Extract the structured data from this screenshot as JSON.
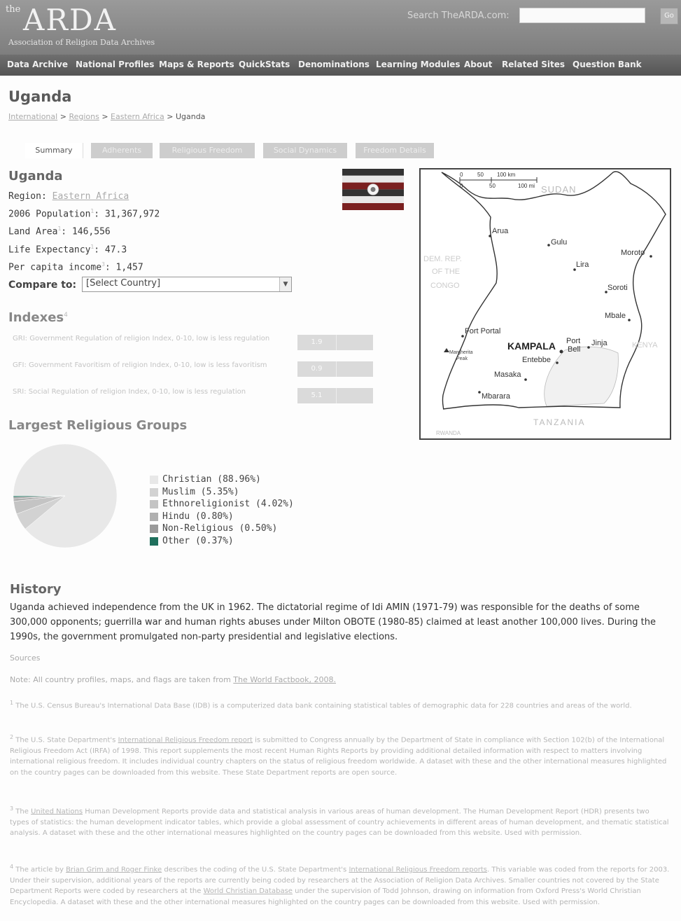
{
  "header": {
    "logo_the": "the",
    "logo_main": "ARDA",
    "logo_sub": "Association of Religion Data Archives",
    "search_label": "Search TheARDA.com:",
    "search_value": "",
    "go_label": "Go"
  },
  "nav": [
    "Data Archive",
    "National Profiles",
    "Maps & Reports",
    "QuickStats",
    "Denominations",
    "Learning Modules",
    "About",
    "Related Sites",
    "Question Bank"
  ],
  "page_title": "Uganda",
  "breadcrumb": {
    "items": [
      "International",
      "Regions",
      "Eastern Africa"
    ],
    "sep": ">",
    "current": "Uganda"
  },
  "tabs": [
    "Summary",
    "Adherents",
    "Religious Freedom",
    "Social Dynamics",
    "Freedom Details"
  ],
  "profile": {
    "heading": "Uganda",
    "region_label": "Region:",
    "region_value": "Eastern Africa",
    "population_label": "2006 Population",
    "population_sup": "1",
    "population_value": "31,367,972",
    "land_label": "Land Area",
    "land_sup": "1",
    "land_value": "146,556",
    "life_label": "Life Expectancy",
    "life_sup": "1",
    "life_value": "47.3",
    "income_label": "Per capita income",
    "income_sup": "3",
    "income_value": "1,457"
  },
  "flag": {
    "colors": [
      "#333333",
      "#e8e8e8",
      "#7a2020",
      "#333333",
      "#e8e8e8",
      "#7a2020"
    ]
  },
  "compare": {
    "label": "Compare to:",
    "selected": "[Select Country]"
  },
  "indexes": {
    "heading": "Indexes",
    "sup": "4",
    "items": [
      {
        "label": "GRI: Government Regulation of religion Index, 0-10, low is less regulation",
        "value": "1.9"
      },
      {
        "label": "GFI: Government Favoritism of religion Index, 0-10, low is less favoritism",
        "value": "0.9"
      },
      {
        "label": "SRI: Social Regulation of religion Index, 0-10, low is less regulation",
        "value": "5.1"
      }
    ]
  },
  "groups": {
    "heading": "Largest Religious Groups",
    "items": [
      {
        "label": "Christian (88.96%)",
        "pct": 88.96,
        "color": "#e8e8e8"
      },
      {
        "label": "Muslim (5.35%)",
        "pct": 5.35,
        "color": "#d2d2d2"
      },
      {
        "label": "Ethnoreligionist (4.02%)",
        "pct": 4.02,
        "color": "#c4c4c4"
      },
      {
        "label": "Hindu (0.80%)",
        "pct": 0.8,
        "color": "#b0b0b0"
      },
      {
        "label": "Non-Religious (0.50%)",
        "pct": 0.5,
        "color": "#9a9a9a"
      },
      {
        "label": "Other (0.37%)",
        "pct": 0.37,
        "color": "#1f6f5c"
      }
    ]
  },
  "map": {
    "scale_top": [
      "0",
      "50",
      "100 km"
    ],
    "scale_bottom": [
      "0",
      "50",
      "100 mi"
    ],
    "countries": [
      "SUDAN",
      "DEM. REP.",
      "OF THE",
      "CONGO",
      "KENYA",
      "TANZANIA",
      "RWANDA"
    ],
    "cities": [
      "Arua",
      "Gulu",
      "Lira",
      "Moroto",
      "Soroti",
      "Mbale",
      "Fort Portal",
      "Margherita",
      "Peak",
      "KAMPALA",
      "Port",
      "Bell",
      "Jinja",
      "Entebbe",
      "Masaka",
      "Mbarara"
    ]
  },
  "history": {
    "heading": "History",
    "text": "Uganda achieved independence from the UK in 1962. The dictatorial regime of Idi AMIN (1971-79) was responsible for the deaths of some 300,000 opponents; guerrilla war and human rights abuses under Milton OBOTE (1980-85) claimed at least another 100,000 lives. During the 1990s, the government promulgated non-party presidential and legislative elections."
  },
  "sources": {
    "label": "Sources",
    "note_prefix": "Note: All country profiles, maps, and flags are taken from",
    "note_link": "The World Factbook, 2008.",
    "fn1_num": "1",
    "fn1": "The U.S. Census Bureau's International Data Base (IDB) is a computerized data bank containing statistical tables of demographic data for 228 countries and areas of the world.",
    "fn2_num": "2",
    "fn2_a": "The U.S. State Department's",
    "fn2_link": "International Religious Freedom report",
    "fn2_b": "is submitted to Congress annually by the Department of State in compliance with Section 102(b) of the International Religious Freedom Act (IRFA) of 1998. This report supplements the most recent Human Rights Reports by providing additional detailed information with respect to matters involving international religious freedom. It includes individual country chapters on the status of religious freedom worldwide. A dataset with these and the other international measures highlighted on the country pages can be downloaded from this website. These State Department reports are open source.",
    "fn3_num": "3",
    "fn3_a": "The",
    "fn3_link": "United Nations",
    "fn3_b": "Human Development Reports provide data and statistical analysis in various areas of human development. The Human Development Report (HDR) presents two types of statistics: the human development indicator tables, which provide a global assessment of country achievements in different areas of human development, and thematic statistical analysis. A dataset with these and the other international measures highlighted on the country pages can be downloaded from this website. Used with permission.",
    "fn4_num": "4",
    "fn4_a": "The article by",
    "fn4_link1": "Brian Grim and Roger Finke",
    "fn4_b": "describes the coding of the U.S. State Department's",
    "fn4_link2": "International Religious Freedom reports",
    "fn4_c": ". This variable was coded from the reports for 2003. Under their supervision, additional years of the reports are currently being coded by researchers at the Association of Religion Data Archives. Smaller countries not covered by the State Department Reports were coded by researchers at the",
    "fn4_link3": "World Christian Database",
    "fn4_d": "under the supervision of Todd Johnson, drawing on information from Oxford Press's World Christian Encyclopedia. A dataset with these and the other international measures highlighted on the country pages can be downloaded from this website. Used with permission."
  }
}
